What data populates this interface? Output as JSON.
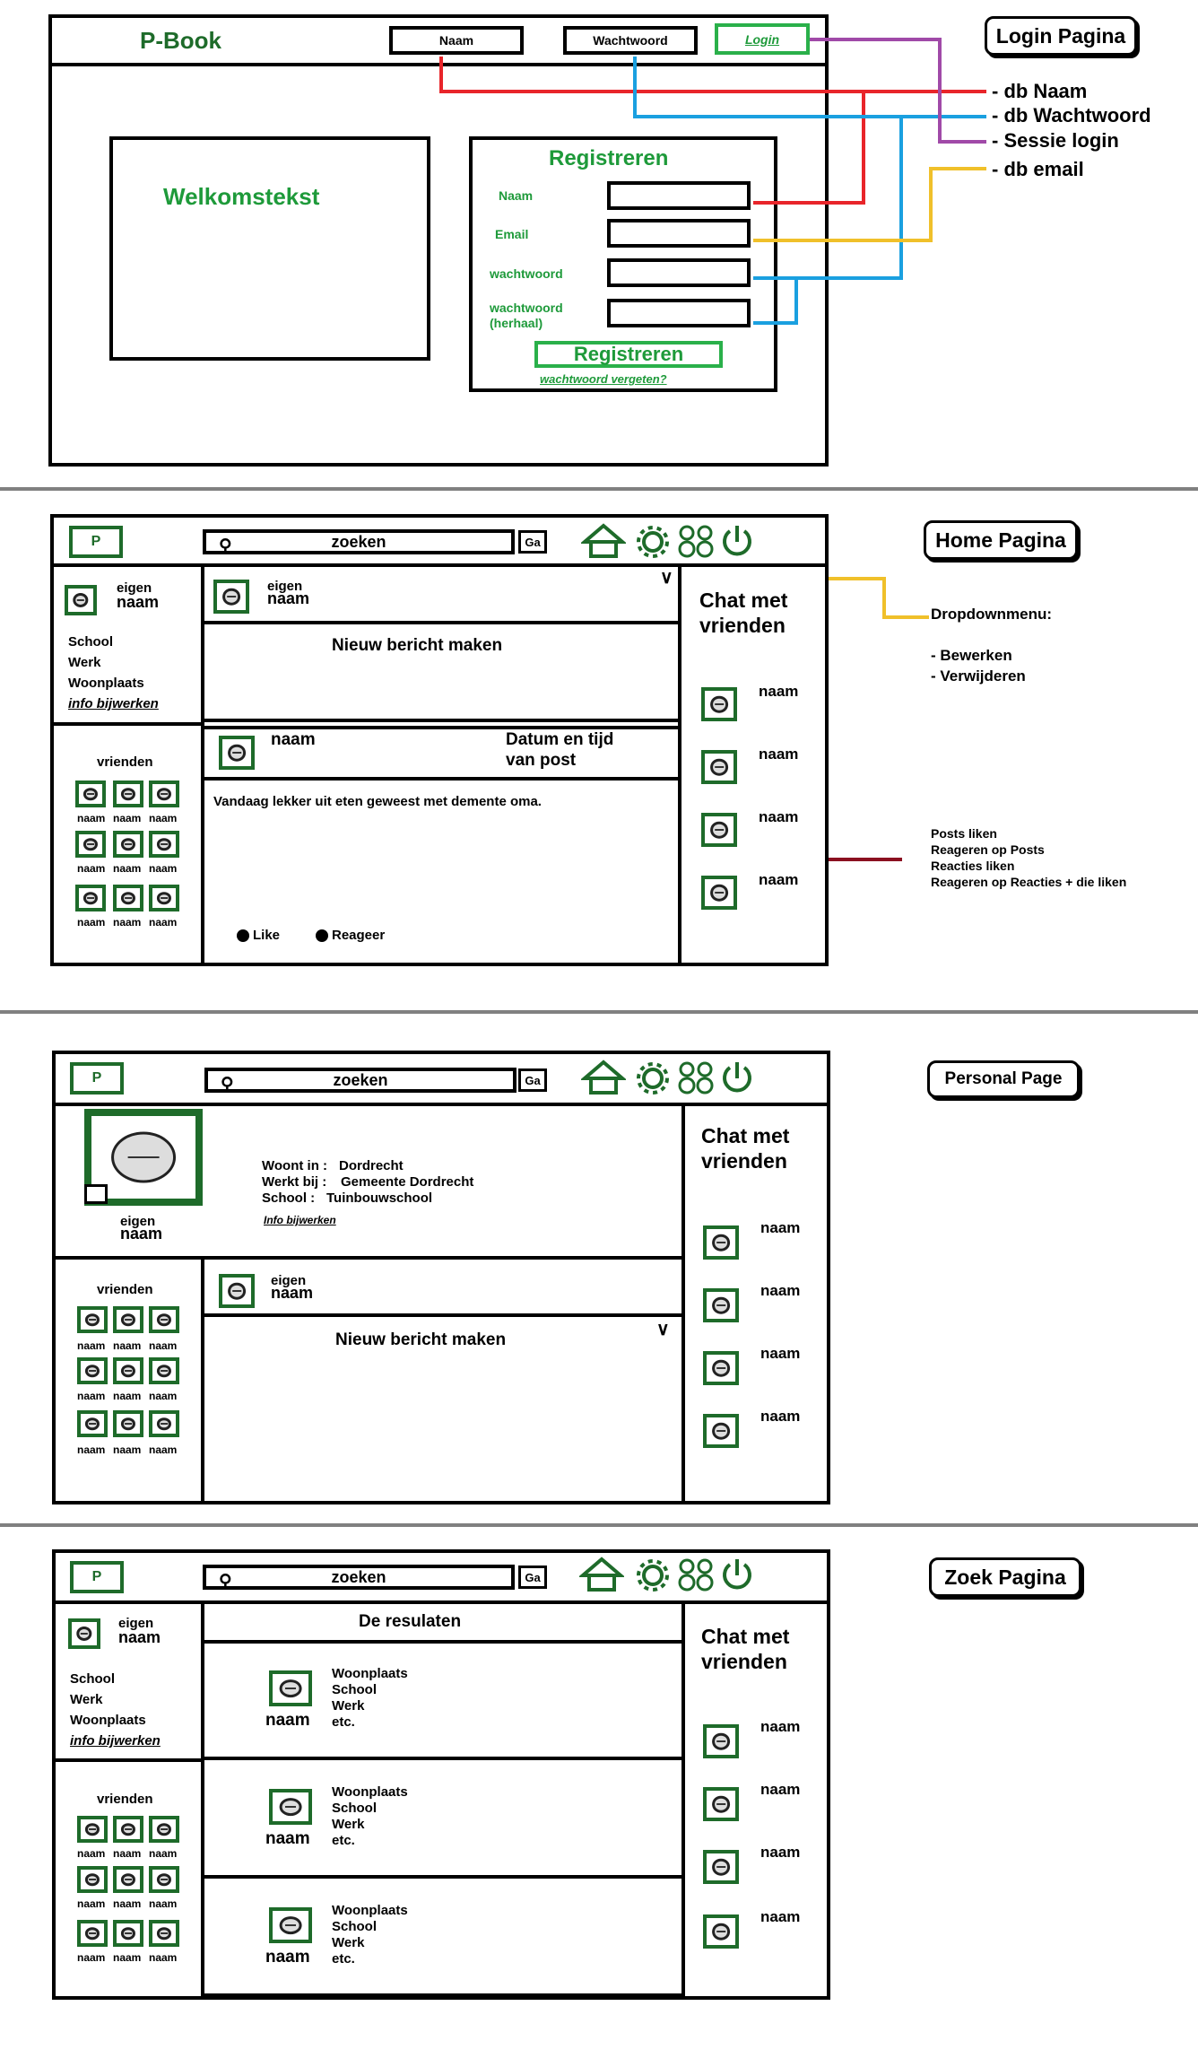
{
  "login": {
    "label": "Login Pagina",
    "logo": "P-Book",
    "header_naam": "Naam",
    "header_wachtwoord": "Wachtwoord",
    "header_login": "Login",
    "welkom": "Welkomstekst",
    "register_title": "Registreren",
    "field_naam": "Naam",
    "field_email": "Email",
    "field_wachtwoord": "wachtwoord",
    "field_wachtwoord_herhaal_1": "wachtwoord",
    "field_wachtwoord_herhaal_2": "(herhaal)",
    "register_button": "Registreren",
    "forgot": "wachtwoord vergeten?",
    "notes": [
      "- db Naam",
      "- db Wachtwoord",
      "- Sessie login",
      "- db email"
    ]
  },
  "common": {
    "logo_letter": "P",
    "search": "zoeken",
    "ga": "Ga",
    "own_name_top": "eigen",
    "own_name_bottom": "naam",
    "school": "School",
    "werk": "Werk",
    "woonplaats": "Woonplaats",
    "info_update": "info bijwerken",
    "vrienden": "vrienden",
    "naam": "naam",
    "chat_1": "Chat met",
    "chat_2": "vrienden",
    "new_post": "Nieuw bericht maken"
  },
  "home": {
    "label": "Home Pagina",
    "post_name": "naam",
    "post_date_1": "Datum en tijd",
    "post_date_2": "van post",
    "post_text": "Vandaag lekker uit eten geweest met demente oma.",
    "like": "Like",
    "reageer": "Reageer",
    "dropdown_title": "Dropdownmenu:",
    "dropdown_items": [
      "- Bewerken",
      "- Verwijderen"
    ],
    "likes_notes": [
      "Posts liken",
      "Reageren op Posts",
      "Reacties liken",
      "Reageren op Reacties + die liken"
    ]
  },
  "personal": {
    "label": "Personal Page",
    "woont_label": "Woont in :",
    "woont_value": "Dordrecht",
    "werkt_label": "Werkt bij :",
    "werkt_value": "Gemeente Dordrecht",
    "school_label": "School :",
    "school_value": "Tuinbouwschool",
    "info_update": "Info bijwerken"
  },
  "search": {
    "label": "Zoek  Pagina",
    "results_title": "De resulaten",
    "result_lines": [
      "Woonplaats",
      "School",
      "Werk",
      "etc."
    ]
  },
  "colors": {
    "red": "#e8252a",
    "blue": "#1aa0e0",
    "purple": "#a04aa8",
    "yellow": "#f0c02a",
    "darkred": "#8b1020",
    "green": "#1e6b2a"
  }
}
